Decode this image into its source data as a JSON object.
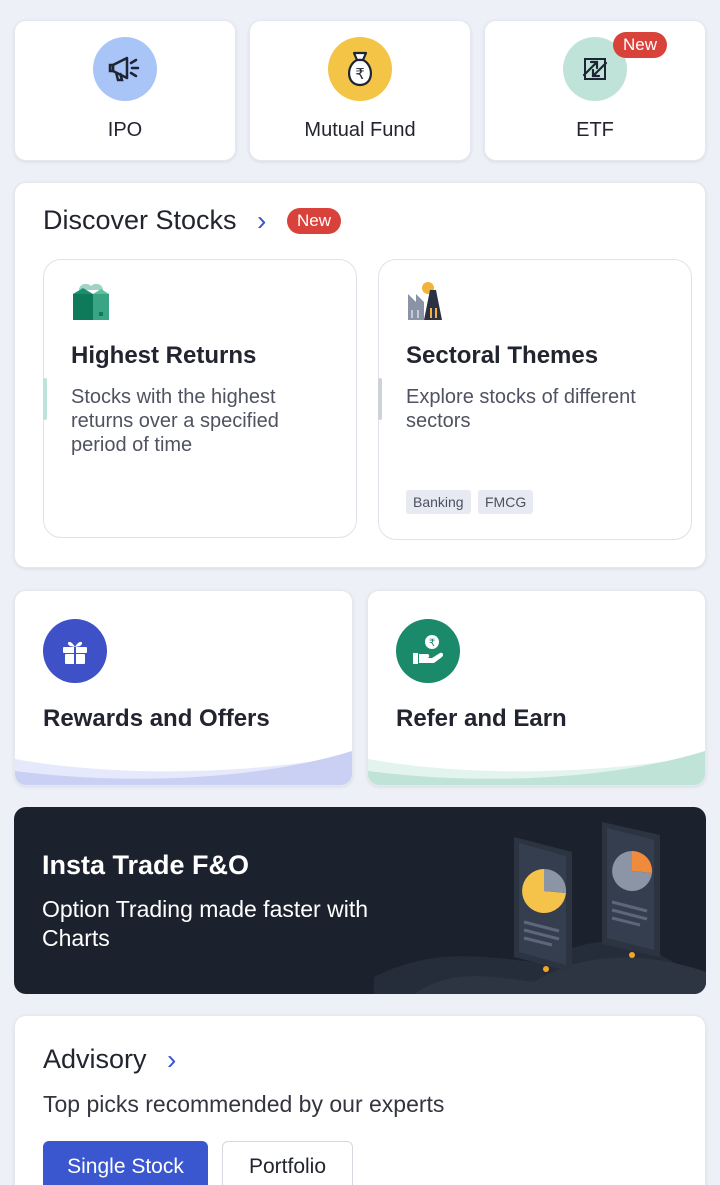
{
  "products": [
    {
      "label": "IPO",
      "icon": "megaphone-icon",
      "bg": "#a9c4f7"
    },
    {
      "label": "Mutual Fund",
      "icon": "money-bag-icon",
      "bg": "#f3c445"
    },
    {
      "label": "ETF",
      "icon": "exchange-arrows-icon",
      "bg": "#bfe3d9",
      "badge": "New"
    }
  ],
  "discover": {
    "title": "Discover Stocks",
    "badge": "New",
    "cards": [
      {
        "title": "Highest Returns",
        "desc": "Stocks with the highest returns over a specified period of time",
        "icon": "building-icon"
      },
      {
        "title": "Sectoral Themes",
        "desc": "Explore stocks of different sectors",
        "icon": "industry-icon",
        "tags": [
          "Banking",
          "FMCG"
        ]
      }
    ]
  },
  "rewards": {
    "label": "Rewards and Offers",
    "icon": "gift-icon",
    "color": "#3f51c6"
  },
  "refer": {
    "label": "Refer and Earn",
    "icon": "hand-rupee-icon",
    "color": "#1a8a6a"
  },
  "insta_trade": {
    "title": "Insta Trade F&O",
    "subtitle": "Option Trading made faster with Charts"
  },
  "advisory": {
    "title": "Advisory",
    "subtitle": "Top picks recommended by our experts",
    "tabs": [
      "Single Stock",
      "Portfolio"
    ],
    "active_tab": "Single Stock"
  },
  "colors": {
    "accent": "#3a57cf",
    "badge": "#d9413b",
    "background": "#eef0f7"
  }
}
